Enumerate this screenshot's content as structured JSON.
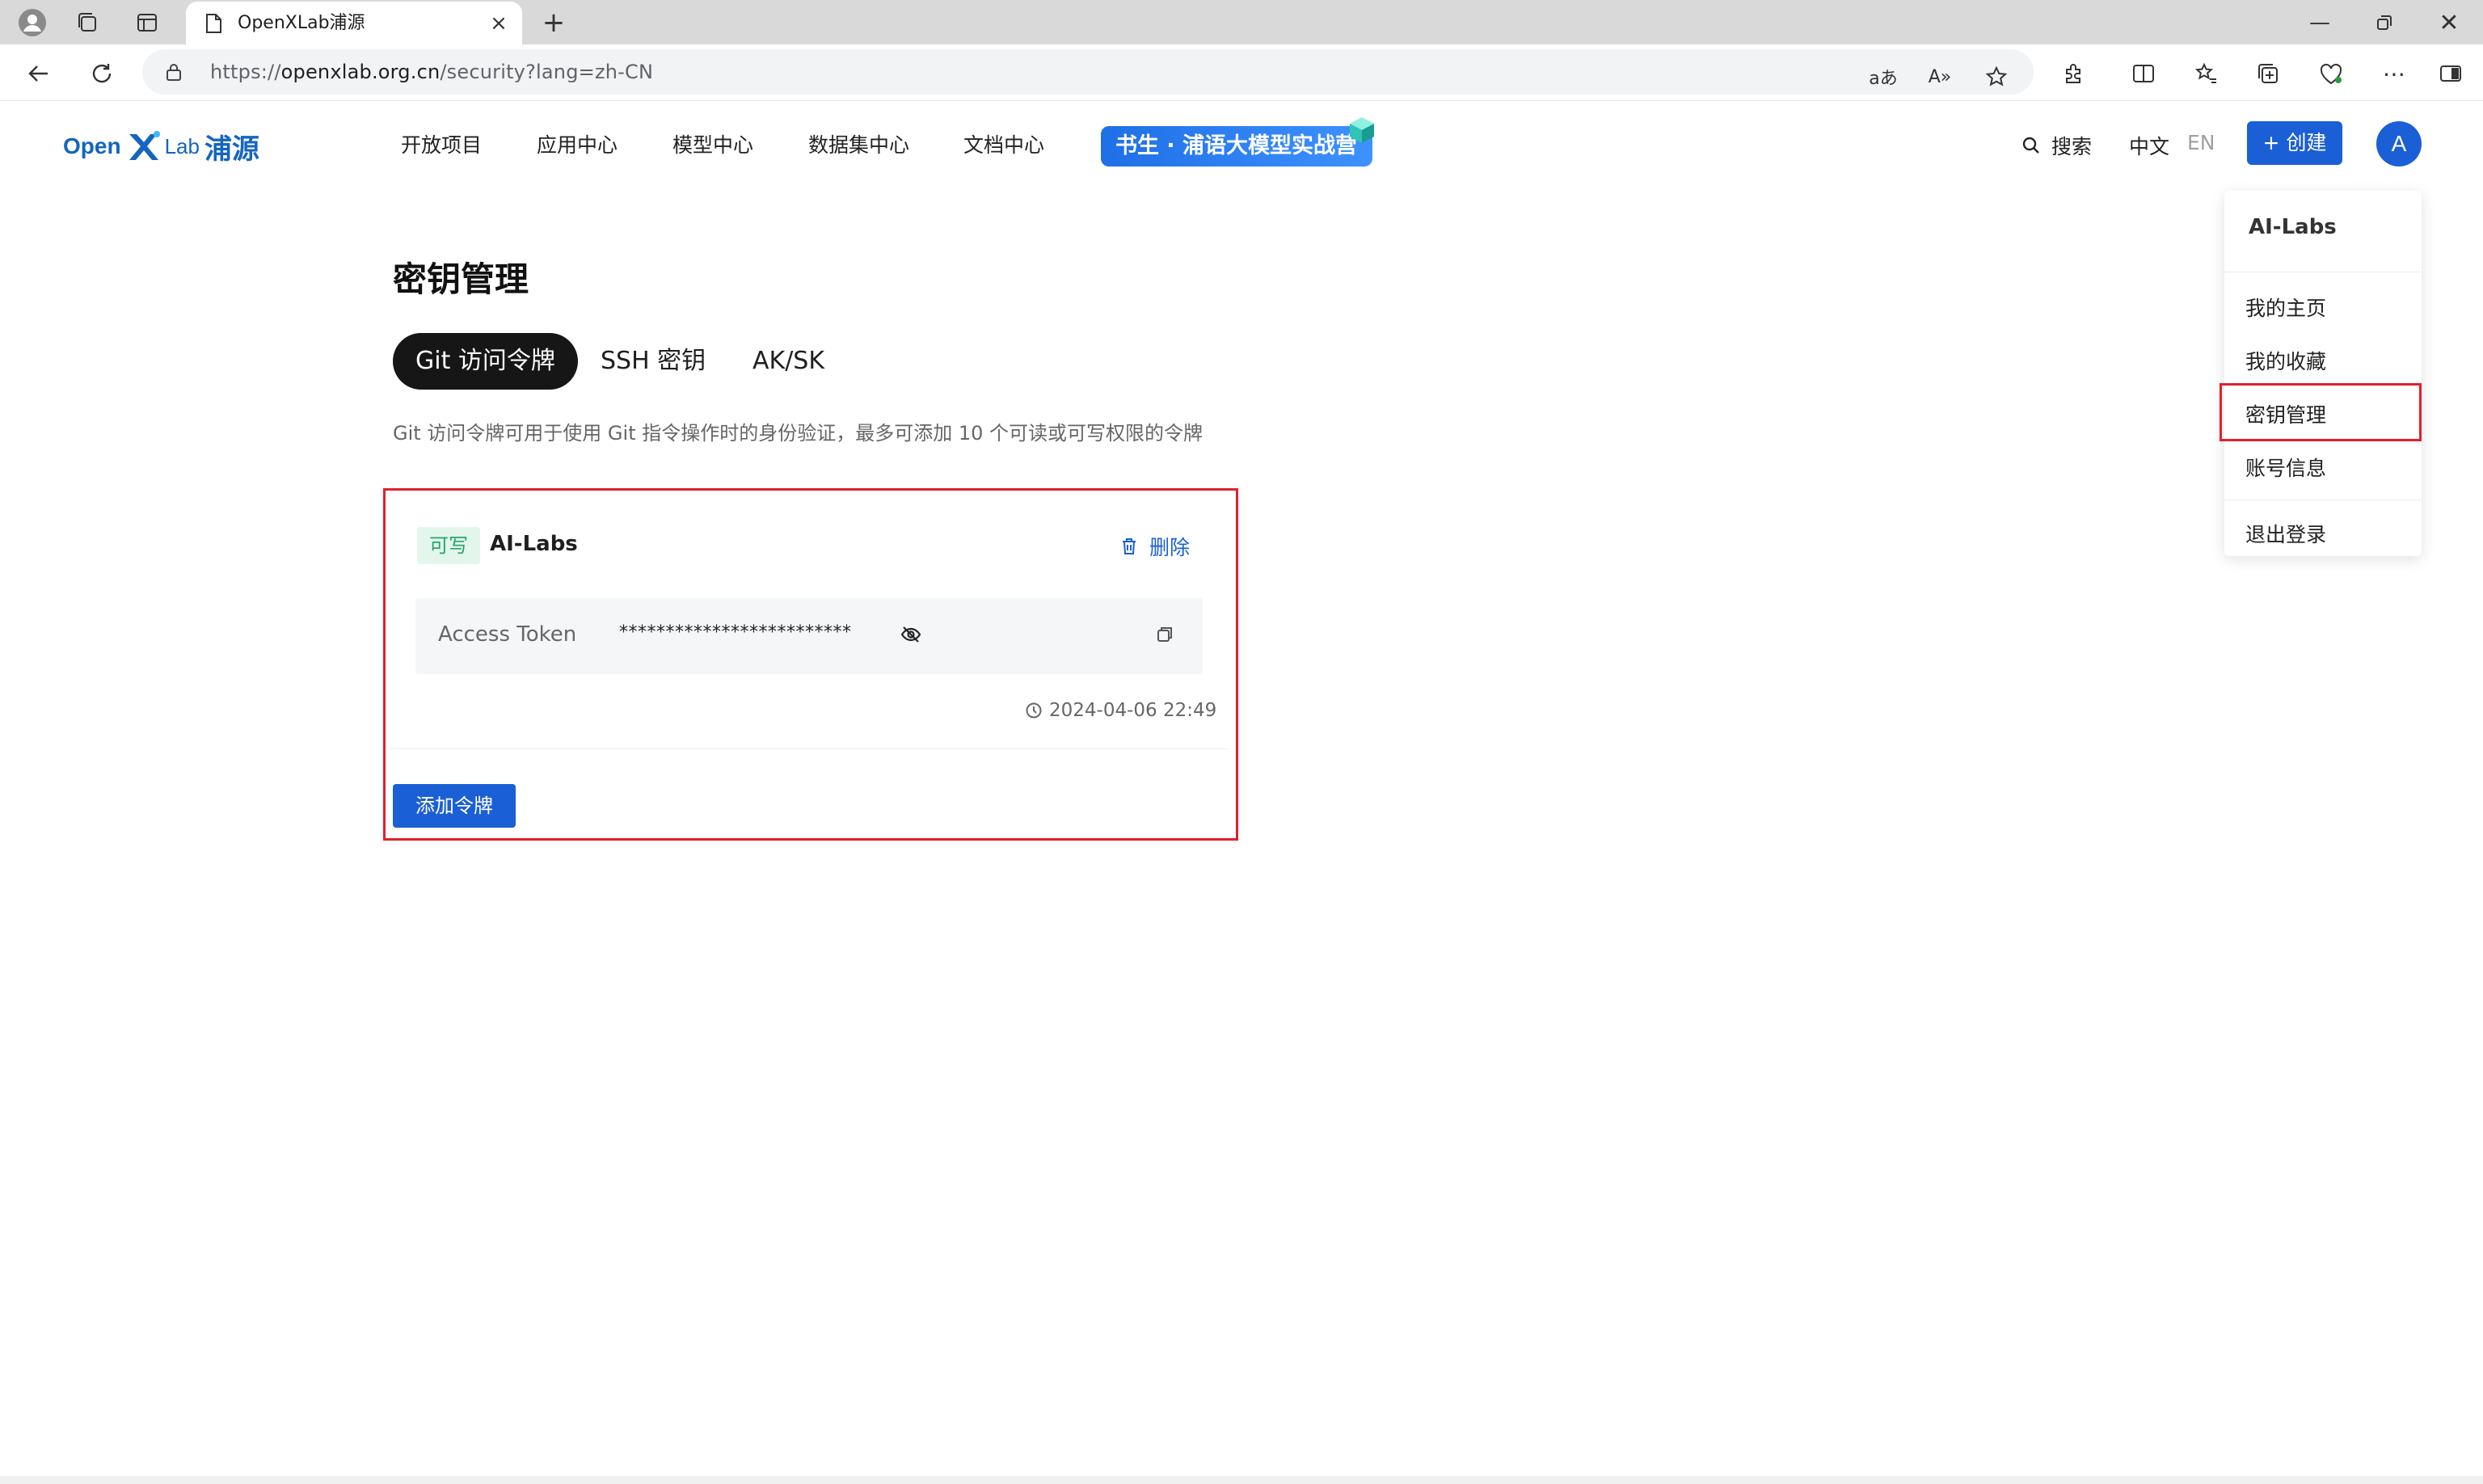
{
  "browser": {
    "tab_title": "OpenXLab浦源",
    "url_prefix": "https://",
    "url_host": "openxlab.org.cn",
    "url_path": "/security?lang=zh-CN"
  },
  "header": {
    "logo_open": "Open",
    "logo_lab": "Lab",
    "logo_cn": "浦源",
    "nav": [
      "开放项目",
      "应用中心",
      "模型中心",
      "数据集中心",
      "文档中心"
    ],
    "promo": "书生 · 浦语大模型实战营",
    "search": "搜索",
    "lang_zh": "中文",
    "lang_en": "EN",
    "create": "+  创建",
    "avatar": "A"
  },
  "main": {
    "title": "密钥管理",
    "tabs": [
      "Git 访问令牌",
      "SSH 密钥",
      "AK/SK"
    ],
    "active_tab": "Git 访问令牌",
    "description": "Git 访问令牌可用于使用 Git 指令操作时的身份验证，最多可添加 10 个可读或可写权限的令牌",
    "token": {
      "permission": "可写",
      "name": "AI-Labs",
      "delete": "删除",
      "label": "Access Token",
      "masked_value": "*************************",
      "date": "2024-04-06 22:49"
    },
    "add_button": "添加令牌"
  },
  "dropdown": {
    "username": "AI-Labs",
    "items": [
      "我的主页",
      "我的收藏",
      "密钥管理",
      "账号信息"
    ],
    "logout": "退出登录"
  },
  "colors": {
    "primary": "#1b5fd6",
    "highlight": "#e0202e",
    "badge_bg": "#e3f6ec",
    "badge_text": "#27a668"
  }
}
